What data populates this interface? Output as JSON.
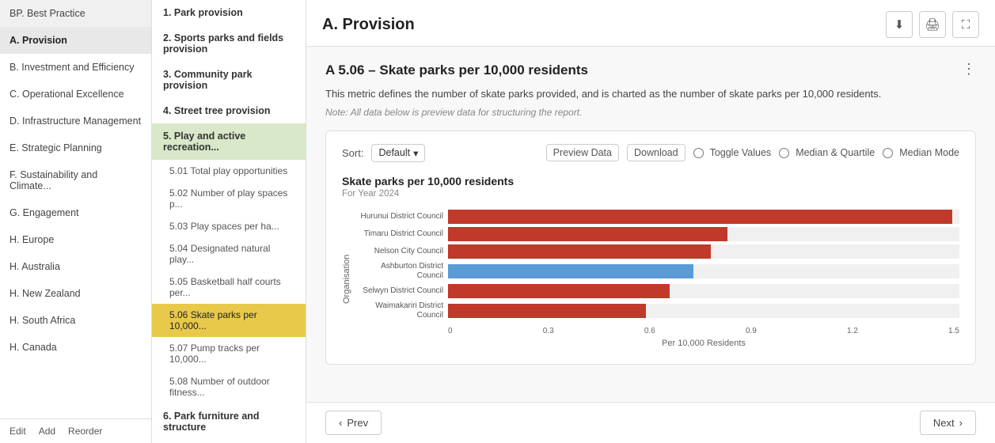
{
  "leftSidebar": {
    "items": [
      {
        "id": "bp",
        "label": "BP. Best Practice",
        "active": false
      },
      {
        "id": "a",
        "label": "A. Provision",
        "active": true
      },
      {
        "id": "b",
        "label": "B. Investment and Efficiency",
        "active": false
      },
      {
        "id": "c",
        "label": "C. Operational Excellence",
        "active": false
      },
      {
        "id": "d",
        "label": "D. Infrastructure Management",
        "active": false
      },
      {
        "id": "e",
        "label": "E. Strategic Planning",
        "active": false
      },
      {
        "id": "f",
        "label": "F. Sustainability and Climate...",
        "active": false
      },
      {
        "id": "g",
        "label": "G. Engagement",
        "active": false
      },
      {
        "id": "h-europe",
        "label": "H. Europe",
        "active": false
      },
      {
        "id": "h-australia",
        "label": "H. Australia",
        "active": false
      },
      {
        "id": "h-newzealand",
        "label": "H. New Zealand",
        "active": false
      },
      {
        "id": "h-southafrica",
        "label": "H. South Africa",
        "active": false
      },
      {
        "id": "h-canada",
        "label": "H. Canada",
        "active": false
      }
    ],
    "footer": {
      "edit": "Edit",
      "add": "Add",
      "reorder": "Reorder"
    }
  },
  "midSidebar": {
    "items": [
      {
        "id": "1",
        "label": "1. Park provision",
        "type": "section"
      },
      {
        "id": "2",
        "label": "2. Sports parks and fields provision",
        "type": "section"
      },
      {
        "id": "3",
        "label": "3. Community park provision",
        "type": "section"
      },
      {
        "id": "4",
        "label": "4. Street tree provision",
        "type": "section"
      },
      {
        "id": "5",
        "label": "5. Play and active recreation...",
        "type": "section",
        "activeSection": true
      },
      {
        "id": "5.01",
        "label": "5.01 Total play opportunities",
        "type": "sub"
      },
      {
        "id": "5.02",
        "label": "5.02 Number of play spaces p...",
        "type": "sub"
      },
      {
        "id": "5.03",
        "label": "5.03 Play spaces per ha...",
        "type": "sub"
      },
      {
        "id": "5.04",
        "label": "5.04 Designated natural play...",
        "type": "sub"
      },
      {
        "id": "5.05",
        "label": "5.05 Basketball half courts per...",
        "type": "sub"
      },
      {
        "id": "5.06",
        "label": "5.06 Skate parks per 10,000...",
        "type": "sub",
        "active": true
      },
      {
        "id": "5.07",
        "label": "5.07 Pump tracks per 10,000...",
        "type": "sub"
      },
      {
        "id": "5.08",
        "label": "5.08 Number of outdoor fitness...",
        "type": "sub"
      },
      {
        "id": "6",
        "label": "6. Park furniture and structure",
        "type": "section"
      }
    ]
  },
  "main": {
    "title": "A. Provision",
    "metricTitle": "A 5.06 – Skate parks per 10,000 residents",
    "metricDesc": "This metric defines the number of skate parks provided, and is charted as the number of skate parks per 10,000 residents.",
    "metricNote": "Note: All data below is preview data for structuring the report.",
    "toolbar": {
      "sortLabel": "Sort:",
      "sortValue": "Default",
      "previewDataLabel": "Preview Data",
      "downloadLabel": "Download",
      "toggleValuesLabel": "Toggle Values",
      "medianQuartileLabel": "Median & Quartile",
      "medianModeLabel": "Median Mode"
    },
    "chart": {
      "title": "Skate parks per 10,000 residents",
      "subtitle": "For Year 2024",
      "yAxisLabel": "Organisation",
      "xAxisLabel": "Per 10,000 Residents",
      "xAxisTicks": [
        "0",
        "0.3",
        "0.6",
        "0.9",
        "1.2",
        "1.5"
      ],
      "bars": [
        {
          "org": "Hurunui District Council",
          "value": 1.48,
          "maxValue": 1.5,
          "color": "orange"
        },
        {
          "org": "Timaru District Council",
          "value": 0.82,
          "maxValue": 1.5,
          "color": "orange"
        },
        {
          "org": "Nelson City Council",
          "value": 0.77,
          "maxValue": 1.5,
          "color": "orange"
        },
        {
          "org": "Ashburton District Council",
          "value": 0.72,
          "maxValue": 1.5,
          "color": "blue"
        },
        {
          "org": "Selwyn District Council",
          "value": 0.65,
          "maxValue": 1.5,
          "color": "orange"
        },
        {
          "org": "Waimakariri District Council",
          "value": 0.58,
          "maxValue": 1.5,
          "color": "orange"
        }
      ]
    },
    "footer": {
      "prevLabel": "Prev",
      "nextLabel": "Next"
    },
    "headerButtons": {
      "download": "⬇",
      "print": "🖨",
      "expand": "⛶"
    }
  }
}
